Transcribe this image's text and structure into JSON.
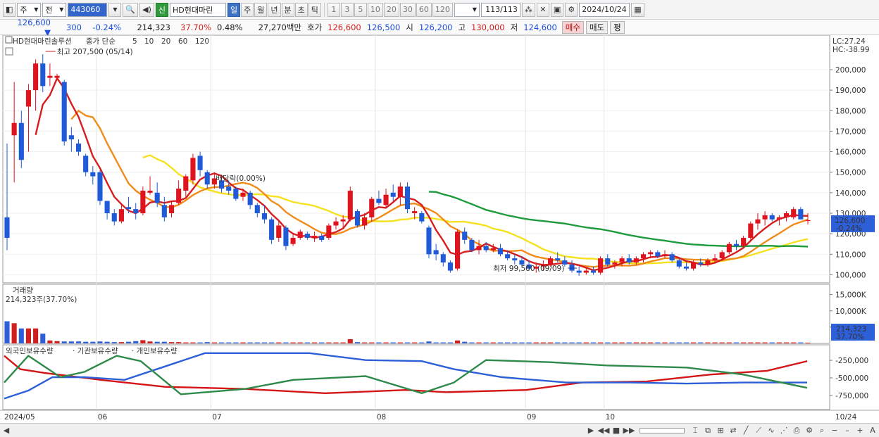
{
  "toolbar": {
    "market": "주",
    "prev_label": "전",
    "code": "443060",
    "new_badge": "신",
    "stock_name": "HD현대마린",
    "periods": [
      "일",
      "주",
      "월",
      "년",
      "분",
      "초",
      "틱"
    ],
    "active_period": "일",
    "minutes": [
      "1",
      "3",
      "5",
      "10",
      "20",
      "30",
      "60",
      "120"
    ],
    "count": "113",
    "count_total": "/113",
    "date": "2024/10/24"
  },
  "infobar": {
    "price": "126,600",
    "change_arrow": "▼",
    "change": "300",
    "change_pct": "-0.24%",
    "volume": "214,323",
    "volume_ratio": "37.70%",
    "turnover": "0.48%",
    "amount": "27,270백만",
    "quote_label": "호가",
    "ask": "126,600",
    "bid": "126,500",
    "open_label": "시",
    "open": "126,200",
    "high_label": "고",
    "high": "130,000",
    "low_label": "저",
    "low": "124,600",
    "buy_label": "매수",
    "sell_label": "매도",
    "avg_label": "평"
  },
  "chart": {
    "price_legend_name": "HD현대마린솔루션",
    "price_legend_ma": "종가 단순",
    "ma_labels": [
      "5",
      "10",
      "20",
      "60",
      "120"
    ],
    "ma_colors": [
      "#d71d1d",
      "#f08c1a",
      "#f5e11d",
      "#1e9b3c",
      "#3a7fd8"
    ],
    "max_label": "최고 207,500 (05/14)",
    "min_label": "최저 99,500 (09/09)",
    "dividend_label": "배당락(0.00%)",
    "lc_label": "LC:27.24",
    "hc_label": "HC:-38.99",
    "price_ticks": [
      "200,000",
      "190,000",
      "180,000",
      "170,000",
      "160,000",
      "150,000",
      "140,000",
      "130,000",
      "120,000",
      "110,000",
      "100,000"
    ],
    "current_price": "126,600",
    "current_pct": "-0.24%",
    "volume_title": "거래량",
    "volume_label": "214,323주(37.70%)",
    "volume_ticks": [
      "15,000K",
      "10,000K",
      "5,000K"
    ],
    "volume_current": "214,323",
    "volume_pct": "37.70%",
    "flow_legend": [
      "외국인보유수량",
      "기관보유수량",
      "개인보유수량"
    ],
    "flow_ticks": [
      "-250,000",
      "-500,000",
      "-750,000"
    ],
    "date_ticks": [
      "2024/05",
      "06",
      "07",
      "08",
      "09",
      "10",
      "10/24"
    ]
  },
  "chart_data": {
    "type": "candlestick",
    "title": "HD현대마린솔루션",
    "ylim": [
      95000,
      212000
    ],
    "candles": [
      [
        128000,
        164000,
        112000,
        118000
      ],
      [
        168000,
        194000,
        145000,
        174000
      ],
      [
        174000,
        180000,
        152000,
        156000
      ],
      [
        182000,
        193000,
        160000,
        190000
      ],
      [
        190000,
        205000,
        180000,
        203000
      ],
      [
        203000,
        207500,
        189000,
        192000
      ],
      [
        196000,
        203000,
        192000,
        197000
      ],
      [
        196000,
        198000,
        195000,
        197000
      ],
      [
        194000,
        195000,
        163000,
        165000
      ],
      [
        168000,
        172000,
        160000,
        166000
      ],
      [
        164000,
        166000,
        158000,
        160000
      ],
      [
        158000,
        159000,
        148000,
        150000
      ],
      [
        150000,
        153000,
        144000,
        148000
      ],
      [
        150000,
        151000,
        134000,
        136000
      ],
      [
        136000,
        136000,
        127000,
        130000
      ],
      [
        130000,
        132000,
        124000,
        126000
      ],
      [
        126000,
        134000,
        125000,
        132000
      ],
      [
        133000,
        138000,
        130000,
        132000
      ],
      [
        132000,
        135000,
        127000,
        130000
      ],
      [
        130000,
        143000,
        129000,
        141000
      ],
      [
        140000,
        148000,
        139000,
        141000
      ],
      [
        140000,
        145000,
        133000,
        135000
      ],
      [
        134000,
        138000,
        126000,
        128000
      ],
      [
        130000,
        136000,
        128000,
        134000
      ],
      [
        135000,
        146000,
        134000,
        142000
      ],
      [
        141000,
        149000,
        138000,
        148000
      ],
      [
        146000,
        159000,
        144000,
        157000
      ],
      [
        158000,
        160000,
        148000,
        151000
      ],
      [
        150000,
        151000,
        142000,
        144000
      ],
      [
        144000,
        150000,
        142000,
        147000
      ],
      [
        146000,
        148000,
        140000,
        142000
      ],
      [
        143000,
        146000,
        139000,
        141000
      ],
      [
        142000,
        143000,
        136000,
        137000
      ],
      [
        138000,
        142000,
        136000,
        140000
      ],
      [
        140000,
        141000,
        132000,
        134000
      ],
      [
        134000,
        135000,
        128000,
        130000
      ],
      [
        130000,
        134000,
        125000,
        127000
      ],
      [
        127000,
        128000,
        115000,
        117000
      ],
      [
        118000,
        126000,
        116000,
        124000
      ],
      [
        123000,
        124000,
        112000,
        114000
      ],
      [
        115000,
        120000,
        114000,
        118000
      ],
      [
        118000,
        122000,
        117000,
        121000
      ],
      [
        120000,
        121000,
        117000,
        118000
      ],
      [
        118000,
        121000,
        116000,
        119000
      ],
      [
        119000,
        120000,
        116000,
        117000
      ],
      [
        118000,
        125000,
        117000,
        124000
      ],
      [
        124000,
        128000,
        122000,
        126000
      ],
      [
        126000,
        129000,
        123000,
        127000
      ],
      [
        127000,
        143000,
        126000,
        141000
      ],
      [
        131000,
        132000,
        123000,
        124000
      ],
      [
        124000,
        130000,
        122000,
        128000
      ],
      [
        128000,
        138000,
        126000,
        137000
      ],
      [
        137000,
        141000,
        134000,
        135000
      ],
      [
        134000,
        142000,
        133000,
        139000
      ],
      [
        140000,
        144000,
        136000,
        138000
      ],
      [
        138000,
        145000,
        134000,
        143000
      ],
      [
        143000,
        145000,
        130000,
        132000
      ],
      [
        130000,
        133000,
        127000,
        131000
      ],
      [
        130000,
        131000,
        125000,
        126000
      ],
      [
        123000,
        124000,
        108000,
        110000
      ],
      [
        112000,
        115000,
        107000,
        110000
      ],
      [
        110000,
        111000,
        104000,
        106000
      ],
      [
        106000,
        107000,
        101000,
        102000
      ],
      [
        103000,
        122000,
        102000,
        121000
      ],
      [
        121000,
        123000,
        115000,
        117000
      ],
      [
        117000,
        118000,
        111000,
        112000
      ],
      [
        112000,
        117000,
        110000,
        114000
      ],
      [
        114000,
        116000,
        111000,
        112000
      ],
      [
        112000,
        115000,
        111000,
        113000
      ],
      [
        113000,
        115000,
        109000,
        110000
      ],
      [
        110000,
        112000,
        107000,
        108000
      ],
      [
        108000,
        110000,
        105000,
        107000
      ],
      [
        107000,
        109000,
        104000,
        105000
      ],
      [
        105000,
        107000,
        102000,
        103000
      ],
      [
        103000,
        106000,
        101000,
        104000
      ],
      [
        104000,
        107000,
        102000,
        105000
      ],
      [
        105000,
        109000,
        104000,
        108000
      ],
      [
        108000,
        111000,
        106000,
        107000
      ],
      [
        107000,
        109000,
        104000,
        105000
      ],
      [
        105000,
        107000,
        101000,
        102000
      ],
      [
        102000,
        104000,
        99500,
        101000
      ],
      [
        101000,
        103000,
        100000,
        102000
      ],
      [
        102000,
        104000,
        100000,
        101000
      ],
      [
        101000,
        109000,
        100000,
        108000
      ],
      [
        108000,
        110000,
        104000,
        105000
      ],
      [
        105000,
        107000,
        103000,
        106000
      ],
      [
        106000,
        109000,
        104000,
        108000
      ],
      [
        108000,
        110000,
        105000,
        106000
      ],
      [
        106000,
        109000,
        105000,
        108000
      ],
      [
        108000,
        111000,
        106000,
        110000
      ],
      [
        110000,
        112000,
        108000,
        111000
      ],
      [
        111000,
        112000,
        108000,
        109000
      ],
      [
        109000,
        112000,
        108000,
        110000
      ],
      [
        110000,
        111000,
        106000,
        107000
      ],
      [
        107000,
        108000,
        103000,
        104000
      ],
      [
        104000,
        106000,
        102000,
        103000
      ],
      [
        103000,
        107000,
        102000,
        106000
      ],
      [
        106000,
        108000,
        104000,
        105000
      ],
      [
        105000,
        108000,
        104000,
        107000
      ],
      [
        107000,
        110000,
        106000,
        108000
      ],
      [
        108000,
        112000,
        107000,
        111000
      ],
      [
        111000,
        116000,
        110000,
        115000
      ],
      [
        115000,
        117000,
        112000,
        114000
      ],
      [
        114000,
        119000,
        113000,
        118000
      ],
      [
        118000,
        126000,
        117000,
        125000
      ],
      [
        125000,
        130000,
        122000,
        127000
      ],
      [
        127000,
        131000,
        124000,
        129000
      ],
      [
        129000,
        130000,
        126000,
        127000
      ],
      [
        127000,
        129000,
        124000,
        128000
      ],
      [
        128000,
        131000,
        126000,
        130000
      ],
      [
        128000,
        133000,
        127000,
        132000
      ],
      [
        132000,
        133000,
        127000,
        127000
      ],
      [
        126200,
        130000,
        124600,
        126600
      ]
    ],
    "volume_k": [
      6800,
      6200,
      4600,
      4600,
      4600,
      3000,
      900,
      700,
      600,
      600,
      600,
      500,
      500,
      600,
      500,
      400,
      400,
      500,
      700,
      1000,
      600,
      500,
      500,
      400,
      400,
      300,
      300,
      300,
      400,
      300,
      300,
      300,
      300,
      300,
      300,
      300,
      300,
      300,
      300,
      300,
      300,
      300,
      300,
      300,
      300,
      300,
      300,
      300,
      1300,
      400,
      300,
      300,
      300,
      300,
      300,
      300,
      300,
      300,
      300,
      600,
      300,
      300,
      300,
      900,
      500,
      300,
      300,
      300,
      300,
      300,
      300,
      300,
      300,
      300,
      300,
      300,
      300,
      300,
      300,
      300,
      300,
      300,
      300,
      300,
      300,
      300,
      300,
      300,
      300,
      300,
      300,
      300,
      300,
      300,
      300,
      300,
      300,
      300,
      300,
      300,
      300,
      300,
      300,
      300,
      300,
      300,
      300,
      300,
      300,
      300,
      300,
      300,
      214
    ],
    "flow_series": [
      {
        "name": "외국인보유수량",
        "color": "#d41515"
      },
      {
        "name": "기관보유수량",
        "color": "#2d5fd8"
      },
      {
        "name": "개인보유수량",
        "color": "#2e8a4a"
      }
    ]
  }
}
